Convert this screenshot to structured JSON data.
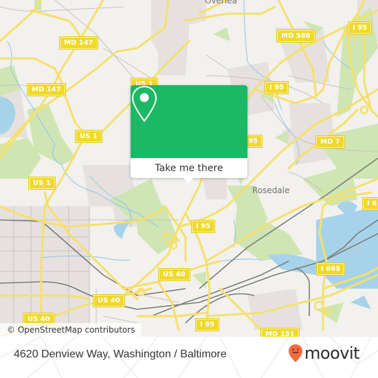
{
  "map": {
    "place_labels": [
      {
        "name": "Overlea"
      },
      {
        "name": "Rosedale"
      }
    ],
    "road_shields": [
      {
        "label": "MD 147"
      },
      {
        "label": "MD 147"
      },
      {
        "label": "US 1"
      },
      {
        "label": "US 1"
      },
      {
        "label": "US 1"
      },
      {
        "label": "MD 588"
      },
      {
        "label": "I 95"
      },
      {
        "label": "I 95"
      },
      {
        "label": "I 95"
      },
      {
        "label": "I 95"
      },
      {
        "label": "MD 7"
      },
      {
        "label": "I 6"
      },
      {
        "label": "I 695"
      },
      {
        "label": "US 40"
      },
      {
        "label": "US 40"
      },
      {
        "label": "US 40"
      },
      {
        "label": "US 40"
      },
      {
        "label": "MD 151"
      }
    ],
    "attribution": "© OpenStreetMap contributors"
  },
  "popup": {
    "icon": "location-pin-icon",
    "button_label": "Take me there",
    "accent_color": "#1db865"
  },
  "footer": {
    "address": "4620 Denview Way, Washington / Baltimore",
    "logo_text": "moovit",
    "logo_color": "#f26a3d"
  }
}
